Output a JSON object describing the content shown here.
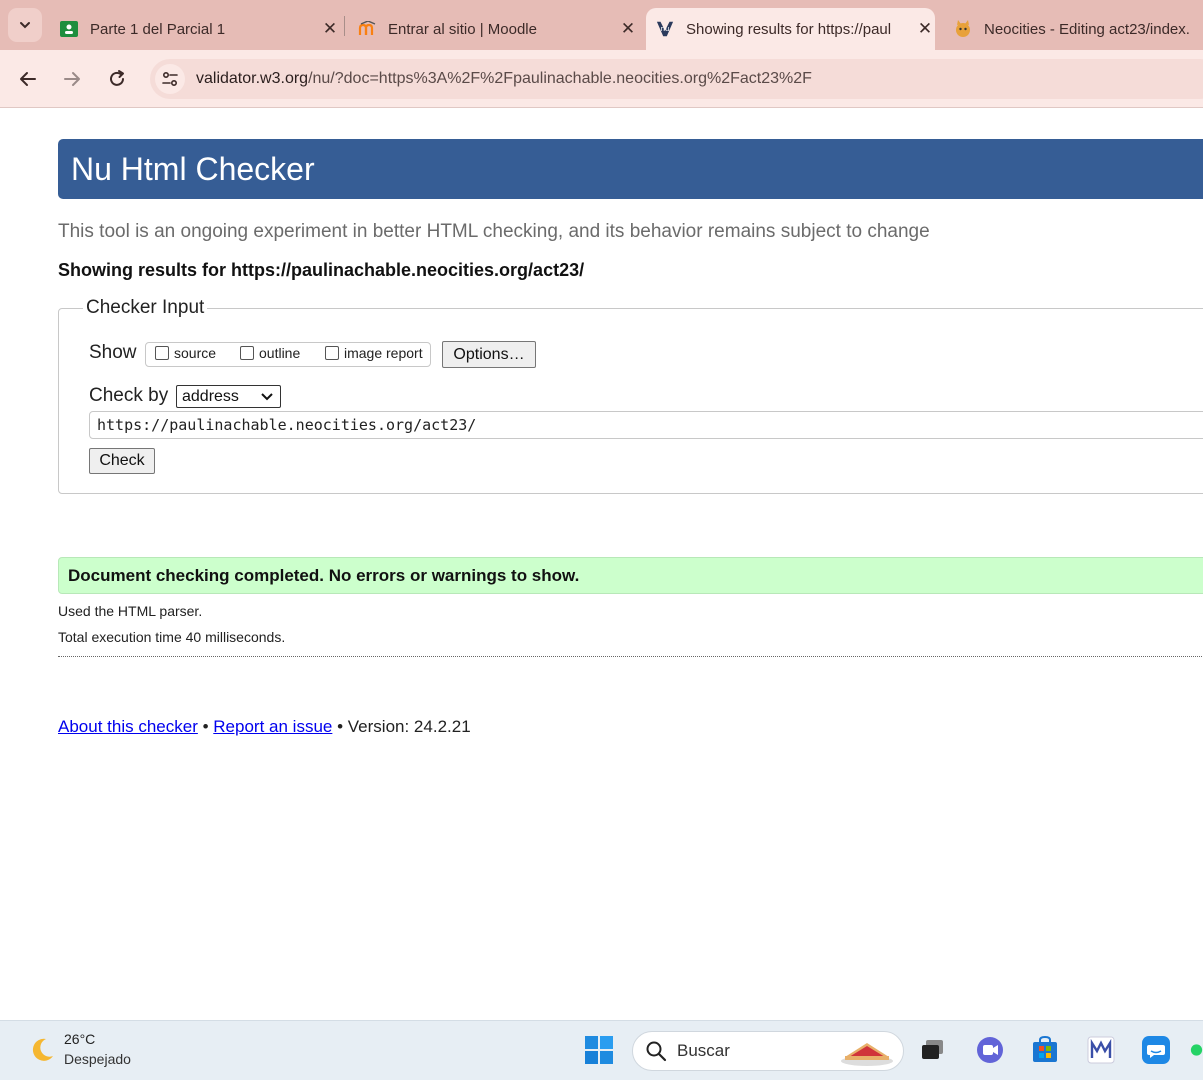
{
  "browser": {
    "tabs": [
      {
        "title": "Parte 1 del Parcial 1",
        "icon": "google-classroom-icon",
        "active": false
      },
      {
        "title": "Entrar al sitio | Moodle",
        "icon": "moodle-icon",
        "active": false
      },
      {
        "title": "Showing results for https://paul",
        "icon": "w3c-validator-icon",
        "active": true
      },
      {
        "title": "Neocities - Editing act23/index.",
        "icon": "neocities-icon",
        "active": false
      }
    ],
    "url_host": "validator.w3.org",
    "url_path": "/nu/?doc=https%3A%2F%2Fpaulinachable.neocities.org%2Fact23%2F"
  },
  "page": {
    "header_title": "Nu Html Checker",
    "tagline": "This tool is an ongoing experiment in better HTML checking, and its behavior remains subject to change",
    "showing_results": "Showing results for https://paulinachable.neocities.org/act23/",
    "form": {
      "legend": "Checker Input",
      "show_label": "Show",
      "show_options": [
        {
          "label": "source",
          "checked": false
        },
        {
          "label": "outline",
          "checked": false
        },
        {
          "label": "image report",
          "checked": false
        }
      ],
      "options_button": "Options…",
      "check_by_label": "Check by",
      "check_by_value": "address",
      "url_value": "https://paulinachable.neocities.org/act23/",
      "check_button": "Check"
    },
    "result_message": "Document checking completed. No errors or warnings to show.",
    "parser_info": "Used the HTML parser.",
    "execution_time": "Total execution time 40 milliseconds.",
    "footer": {
      "about_link": "About this checker",
      "separator": "•",
      "report_link": "Report an issue",
      "version_text": "Version: 24.2.21"
    }
  },
  "taskbar": {
    "weather_temp": "26°C",
    "weather_desc": "Despejado",
    "search_placeholder": "Buscar"
  },
  "colors": {
    "banner": "#365d95",
    "success_bg": "#ccffcc",
    "link": "#0000ee",
    "tabstrip": "#e6bcb6"
  }
}
